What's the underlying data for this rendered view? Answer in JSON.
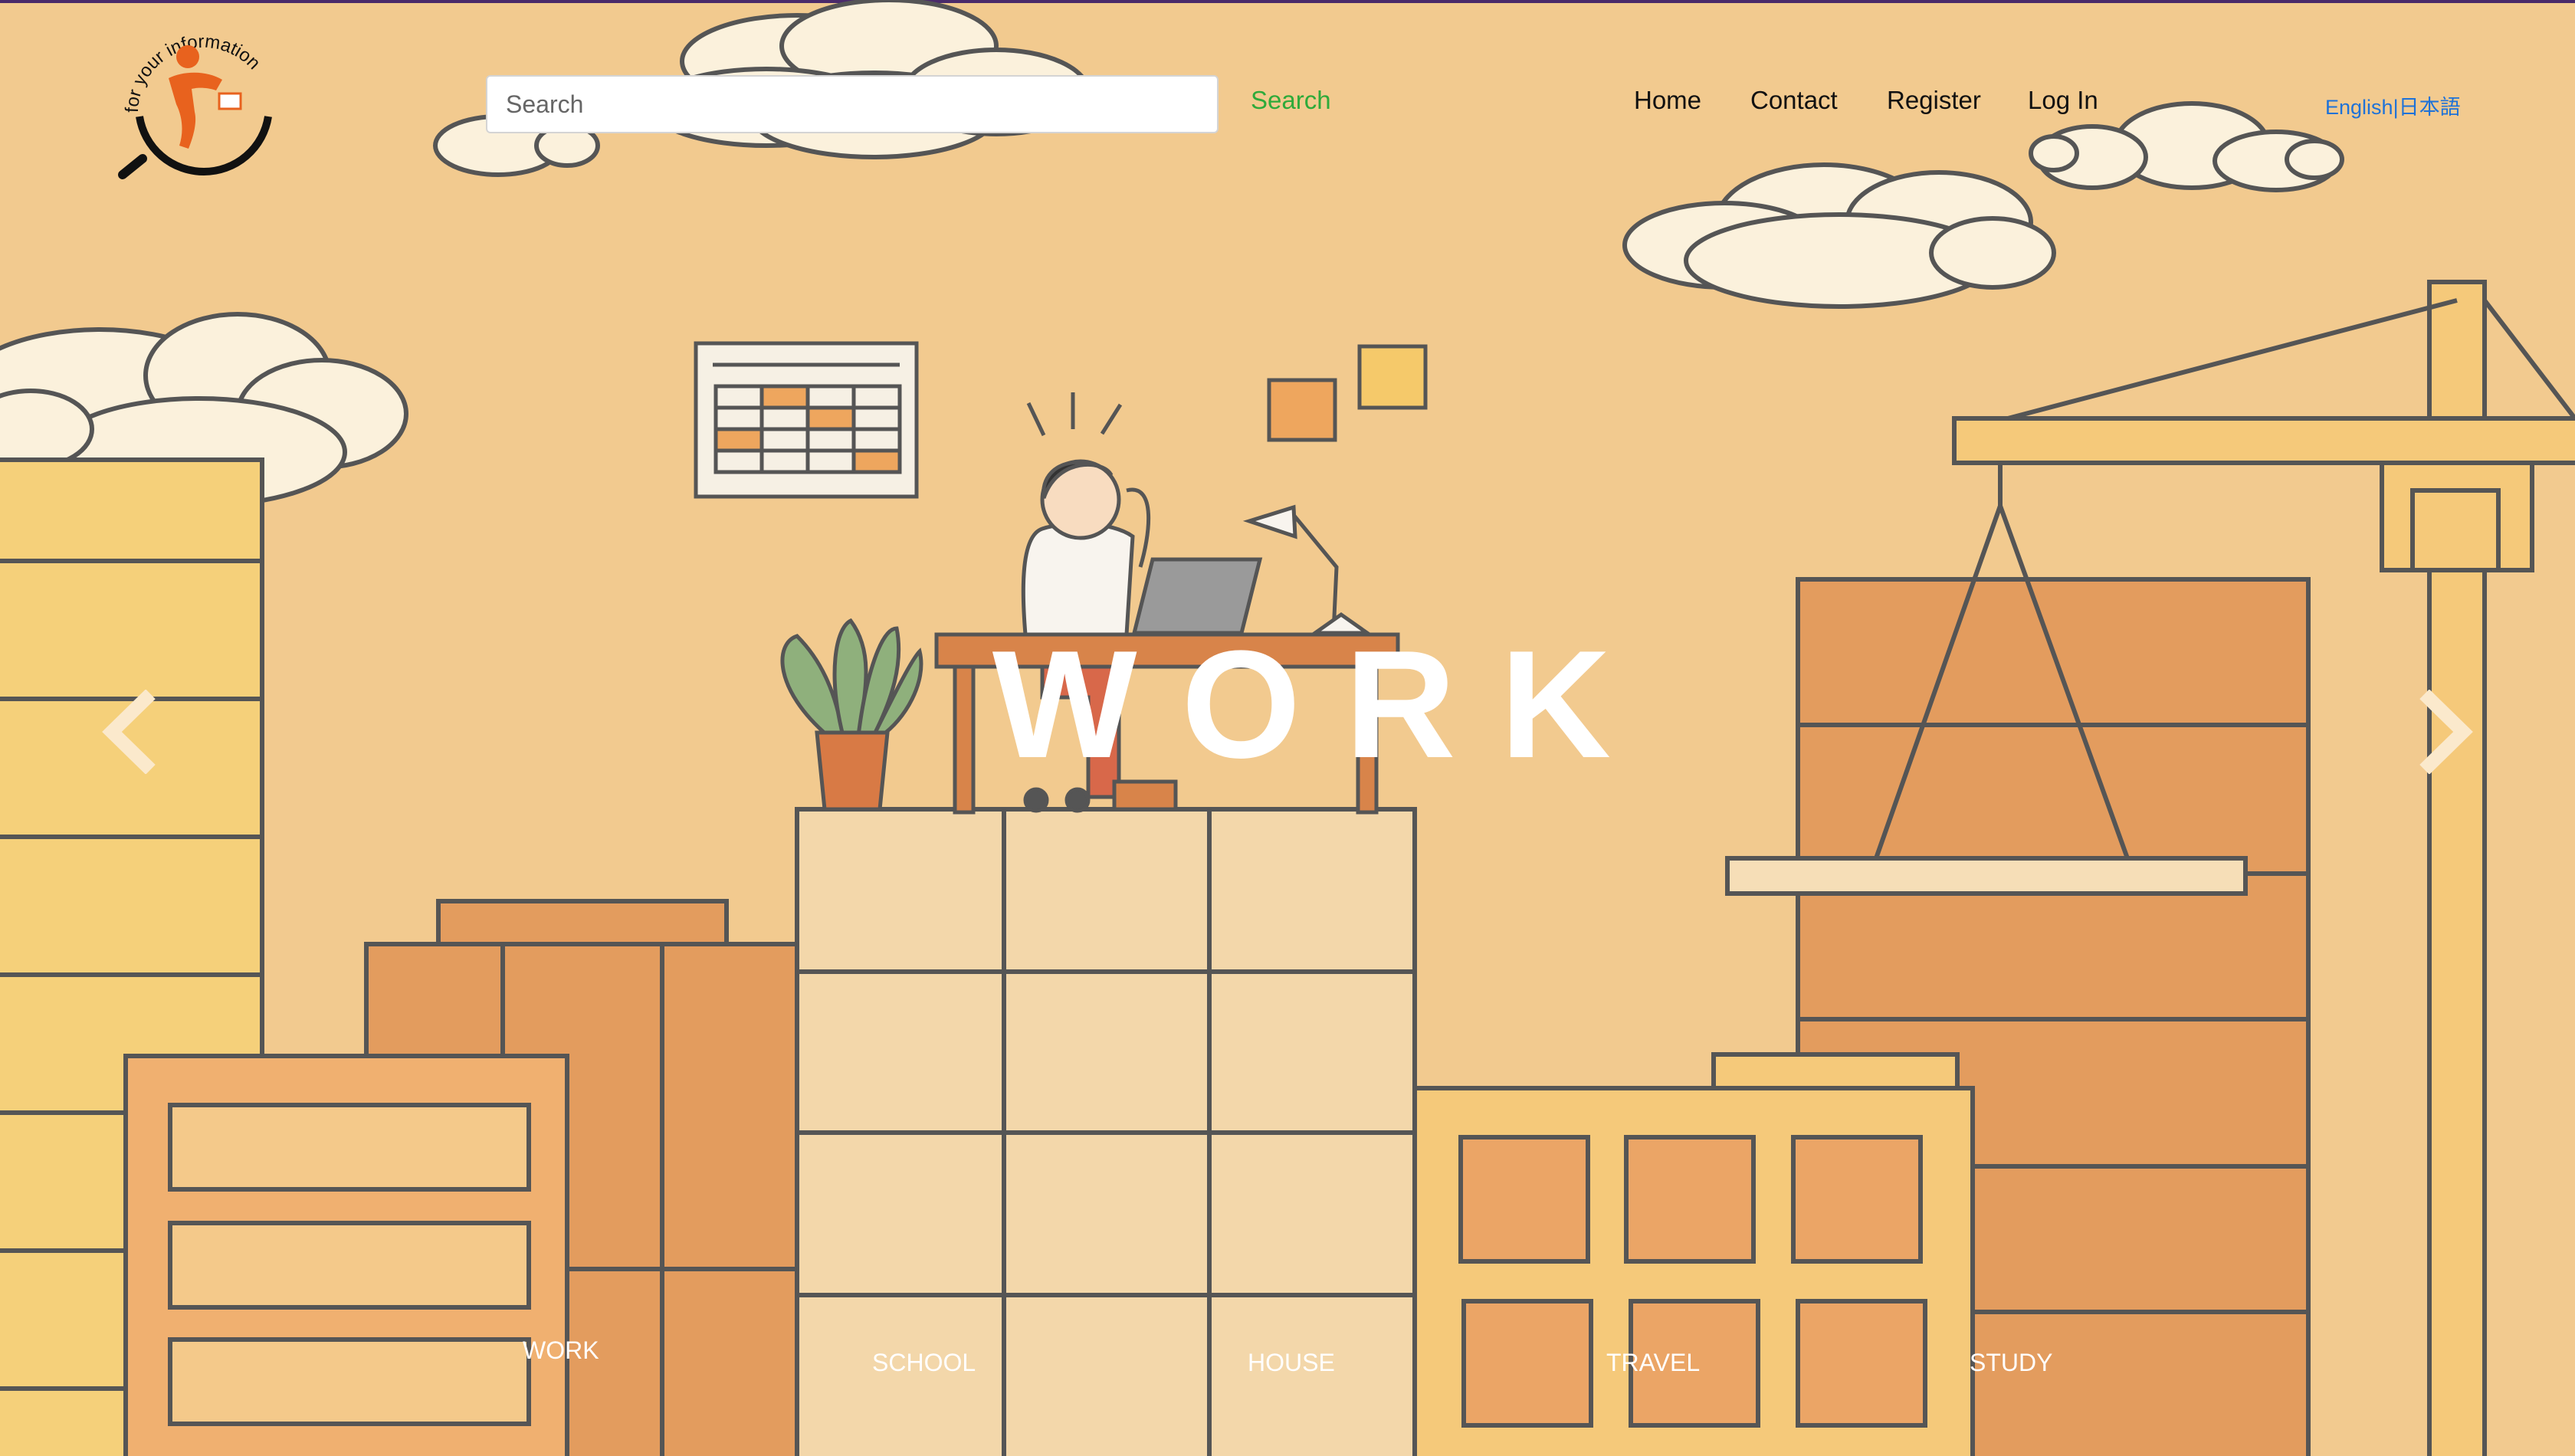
{
  "header": {
    "logo_alt": "for your information",
    "search": {
      "placeholder": "Search",
      "value": "",
      "button_label": "Search"
    },
    "nav": [
      {
        "label": "Home"
      },
      {
        "label": "Contact"
      },
      {
        "label": "Register"
      },
      {
        "label": "Log In"
      }
    ],
    "language": {
      "english": "English",
      "separator": "|",
      "japanese": "日本語"
    }
  },
  "carousel": {
    "active_title": "WORK",
    "prev_icon": "chevron-left-icon",
    "next_icon": "chevron-right-icon",
    "indicators": [
      {
        "label": "WORK"
      },
      {
        "label": "SCHOOL"
      },
      {
        "label": "HOUSE"
      },
      {
        "label": "TRAVEL"
      },
      {
        "label": "STUDY"
      }
    ]
  },
  "colors": {
    "background": "#f2ca8f",
    "search_button": "#2eaa3a",
    "language_link": "#1e72d8",
    "logo_accent": "#e8621e",
    "hero_text": "#ffffff"
  }
}
